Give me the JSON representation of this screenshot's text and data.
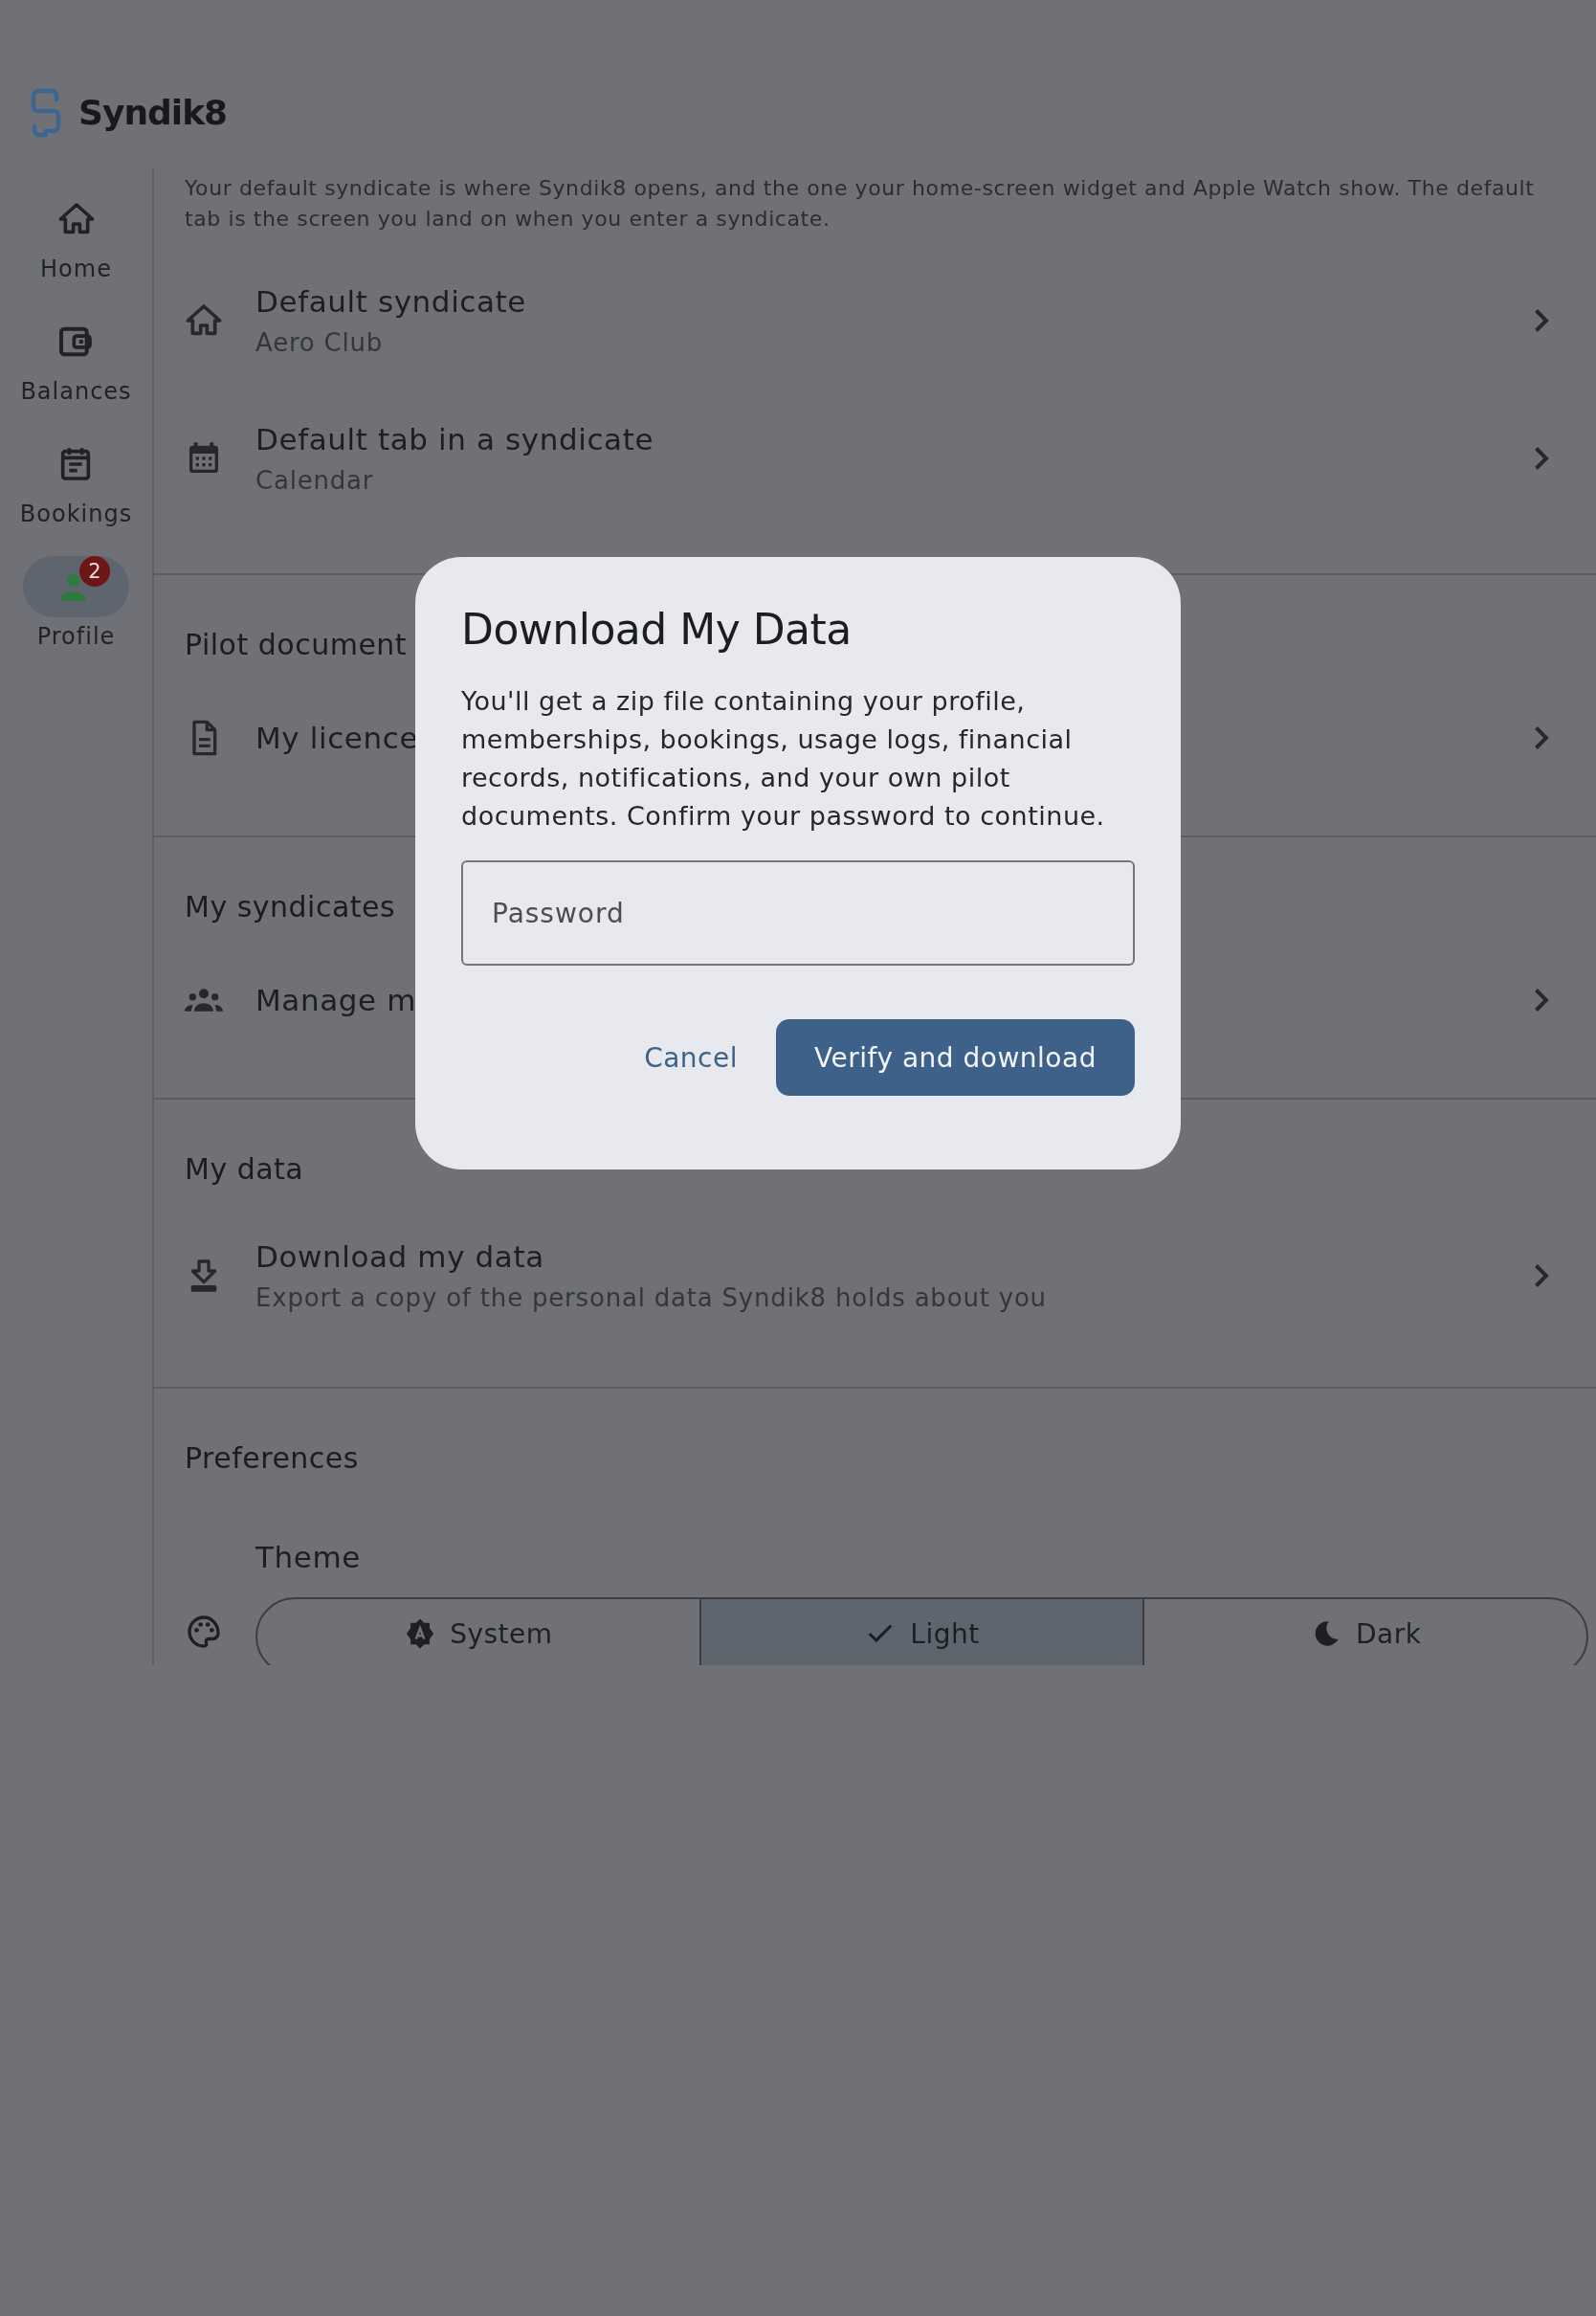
{
  "app": {
    "name": "Syndik8"
  },
  "nav": [
    {
      "label": "Home",
      "kind": "home",
      "selected": false
    },
    {
      "label": "Balances",
      "kind": "wallet",
      "selected": false
    },
    {
      "label": "Bookings",
      "kind": "bookings",
      "selected": false
    },
    {
      "label": "Profile",
      "kind": "person",
      "selected": true,
      "badge": "2"
    }
  ],
  "intro": "Your default syndicate is where Syndik8 opens, and the one your home-screen widget and Apple Watch show. The default tab is the screen you land on when you enter a syndicate.",
  "sections": [
    {
      "items": [
        {
          "kind": "home",
          "title": "Default syndicate",
          "subtitle": "Aero Club"
        },
        {
          "kind": "calendar",
          "title": "Default tab in a syndicate",
          "subtitle": "Calendar"
        }
      ]
    },
    {
      "heading": "Pilot document",
      "items": [
        {
          "kind": "document",
          "title": "My licence"
        }
      ]
    },
    {
      "heading": "My syndicates",
      "items": [
        {
          "kind": "group",
          "title": "Manage m"
        }
      ]
    },
    {
      "heading": "My data",
      "items": [
        {
          "kind": "download",
          "title": "Download my data",
          "subtitle": "Export a copy of the personal data Syndik8 holds about you"
        }
      ]
    },
    {
      "heading": "Preferences",
      "theme": {
        "label": "Theme",
        "options": [
          {
            "label": "System",
            "kind": "auto",
            "selected": false
          },
          {
            "label": "Light",
            "kind": "check",
            "selected": true
          },
          {
            "label": "Dark",
            "kind": "moon",
            "selected": false
          }
        ]
      }
    }
  ],
  "dialog": {
    "title": "Download My Data",
    "body": "You'll get a zip file containing your profile, memberships, bookings, usage logs, financial records, notifications, and your own pilot documents. Confirm your password to continue.",
    "password": {
      "placeholder": "Password"
    },
    "buttons": [
      {
        "label": "Cancel",
        "kind": "text"
      },
      {
        "label": "Verify and download",
        "kind": "filled"
      }
    ]
  }
}
